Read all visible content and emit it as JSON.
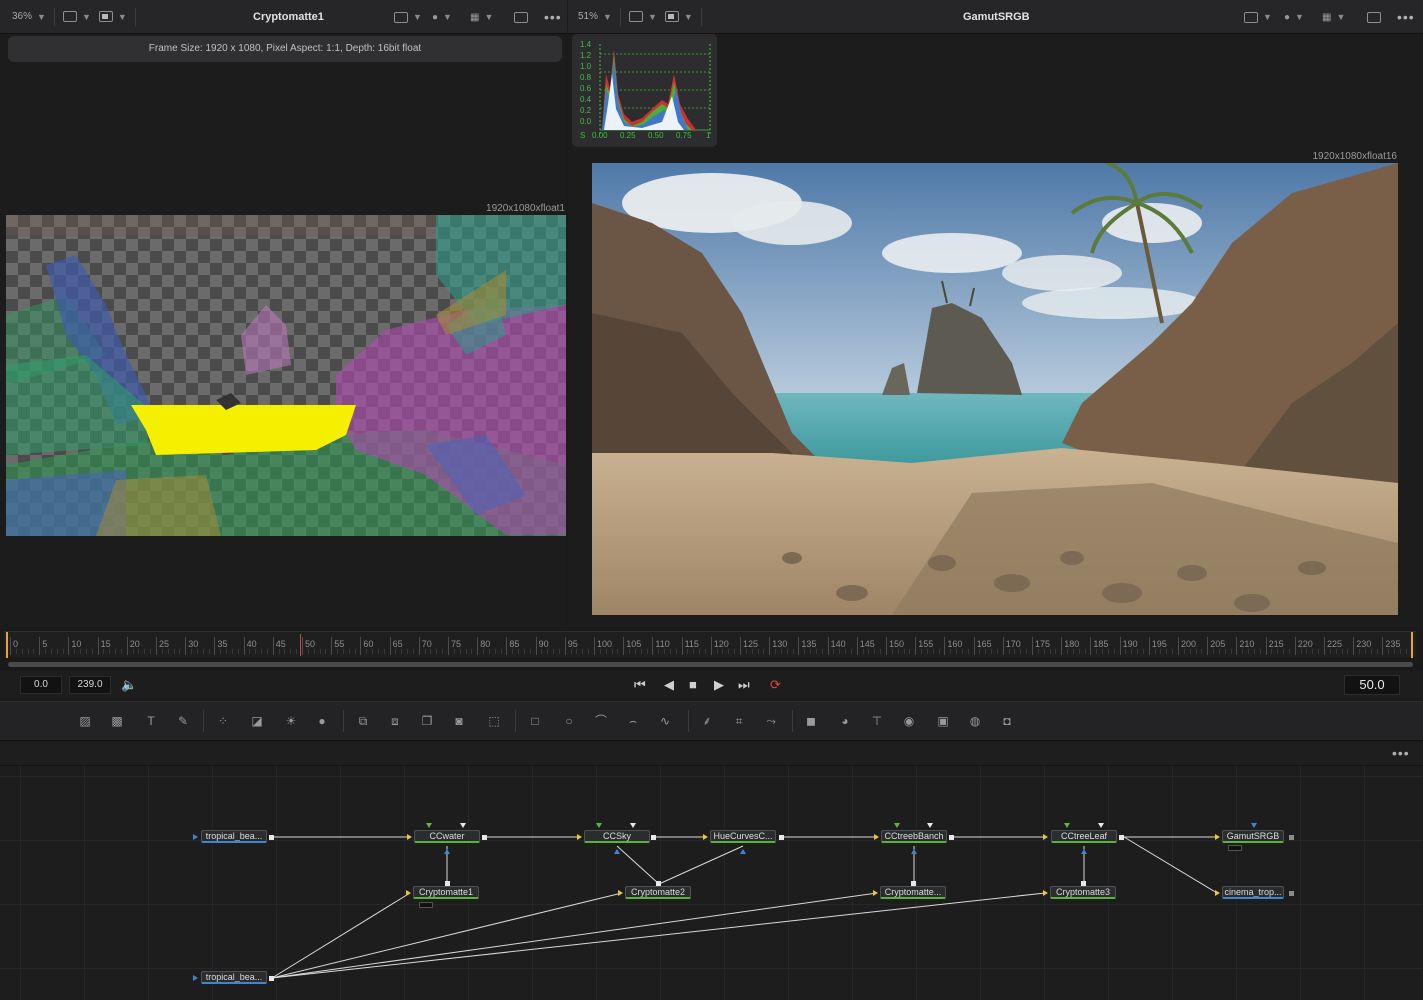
{
  "left_viewer": {
    "zoom": "36%",
    "title": "Cryptomatte1",
    "info": "Frame Size: 1920 x 1080, Pixel Aspect: 1:1, Depth: 16bit float",
    "resolution": "1920x1080xfloat1"
  },
  "right_viewer": {
    "zoom": "51%",
    "title": "GamutSRGB",
    "resolution": "1920x1080xfloat16"
  },
  "histogram": {
    "y_labels": [
      "1.4",
      "1.2",
      "1.0",
      "0.8",
      "0.6",
      "0.4",
      "0.2",
      "0.0"
    ],
    "x_labels": [
      "S",
      "0.00",
      "0.25",
      "0.50",
      "0.75",
      "1"
    ]
  },
  "timeline": {
    "ticks": [
      "0",
      "5",
      "10",
      "15",
      "20",
      "25",
      "30",
      "35",
      "40",
      "45",
      "50",
      "55",
      "60",
      "65",
      "70",
      "75",
      "80",
      "85",
      "90",
      "95",
      "100",
      "105",
      "110",
      "115",
      "120",
      "125",
      "130",
      "135",
      "140",
      "145",
      "150",
      "155",
      "160",
      "165",
      "170",
      "175",
      "180",
      "185",
      "190",
      "195",
      "200",
      "205",
      "210",
      "215",
      "220",
      "225",
      "230",
      "235"
    ],
    "playhead_frame": 50
  },
  "transport": {
    "start": "0.0",
    "end": "239.0",
    "current_frame": "50.0"
  },
  "toolbar_icons": [
    "background-icon",
    "image-icon",
    "text-icon",
    "paint-icon",
    "particles-icon",
    "curves-icon",
    "brightness-icon",
    "blur-icon",
    "merge-icon",
    "layer-icon",
    "copy-icon",
    "viewer-icon",
    "transform-icon",
    "rectangle-icon",
    "ellipse-icon",
    "polygon-icon",
    "bspline-icon",
    "bitmap-icon",
    "tracker-icon",
    "planar-icon",
    "warp-icon",
    "3d-shape-icon",
    "3d-sphere-icon",
    "3d-text-icon",
    "3d-camera-icon",
    "3d-merge-icon",
    "3d-light-icon",
    "3d-render-icon"
  ],
  "nodes": {
    "loader_top": "tropical_bea...",
    "loader_bottom": "tropical_bea...",
    "ccwater": "CCwater",
    "ccsky": "CCSky",
    "huecurves": "HueCurvesC...",
    "cctreebranch": "CCtreebBanch",
    "cctreeleaf": "CCtreeLeaf",
    "gamut": "GamutSRGB",
    "crypto1": "Cryptomatte1",
    "crypto2": "Cryptomatte2",
    "crypto_mid": "Cryptomatte...",
    "crypto3": "Cryptomatte3",
    "saver": "cinema_trop..."
  },
  "colors": {
    "matte_yellow": "#f5f000",
    "node_green": "#58b53a",
    "node_blue": "#3d86d0",
    "connector_yellow": "#e8c53a",
    "loop_red": "#e0443a"
  }
}
